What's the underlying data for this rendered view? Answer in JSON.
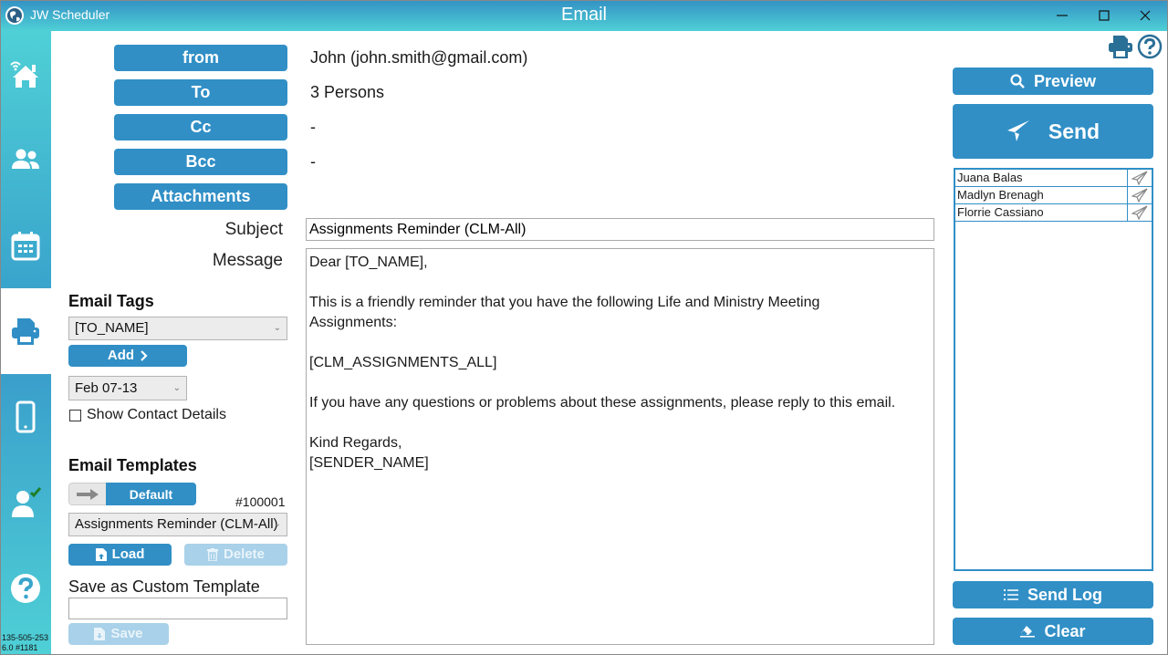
{
  "titlebar": {
    "app_name": "JW Scheduler",
    "window_title": "Email",
    "app_icon": "globe-icon",
    "controls": [
      "minimize-icon",
      "maximize-icon",
      "close-icon"
    ]
  },
  "sidebar": {
    "items": [
      {
        "name": "home",
        "icon": "home-wifi-icon"
      },
      {
        "name": "people",
        "icon": "people-icon"
      },
      {
        "name": "calendar",
        "icon": "calendar-icon"
      },
      {
        "name": "print",
        "icon": "printer-icon",
        "active": true
      },
      {
        "name": "mobile",
        "icon": "mobile-icon"
      },
      {
        "name": "user-check",
        "icon": "user-check-icon"
      },
      {
        "name": "help",
        "icon": "help-icon"
      }
    ],
    "footer_line1": "135-505-253",
    "footer_line2": "6.0 #1181"
  },
  "fields": {
    "from_label": "from",
    "from_value": "John (john.smith@gmail.com)",
    "to_label": "To",
    "to_value": "3 Persons",
    "cc_label": "Cc",
    "cc_value": "-",
    "bcc_label": "Bcc",
    "bcc_value": "-",
    "attachments_label": "Attachments"
  },
  "compose": {
    "subject_label": "Subject",
    "subject_value": "Assignments Reminder (CLM-All)",
    "message_label": "Message",
    "message_value": "Dear [TO_NAME],\n\nThis is a friendly reminder that you have the following Life and Ministry Meeting\nAssignments:\n\n[CLM_ASSIGNMENTS_ALL]\n\nIf you have any questions or problems about these assignments, please reply to this email.\n\nKind Regards,\n[SENDER_NAME]"
  },
  "email_tags": {
    "heading": "Email Tags",
    "selected_tag": "[TO_NAME]",
    "add_label": "Add",
    "week_selected": "Feb 07-13",
    "show_contact_details_label": "Show Contact Details",
    "show_contact_details_checked": false
  },
  "email_templates": {
    "heading": "Email Templates",
    "toggle_label": "Default",
    "template_id": "#100001",
    "selected_template": "Assignments Reminder (CLM-All)",
    "load_label": "Load",
    "delete_label": "Delete",
    "custom_heading": "Save as Custom Template",
    "custom_value": "",
    "save_label": "Save"
  },
  "actions": {
    "preview_label": "Preview",
    "send_label": "Send",
    "send_log_label": "Send Log",
    "clear_label": "Clear"
  },
  "recipients": [
    {
      "name": "Juana Balas"
    },
    {
      "name": "Madlyn Brenagh"
    },
    {
      "name": "Florrie Cassiano"
    }
  ],
  "colors": {
    "accent": "#318fc6",
    "accent_disabled": "#a9d1e9",
    "titlebar_top": "#3391c4",
    "titlebar_bottom": "#4fd0d6",
    "check_green": "#1e7d2a",
    "icon_dark": "#2a6f96"
  }
}
